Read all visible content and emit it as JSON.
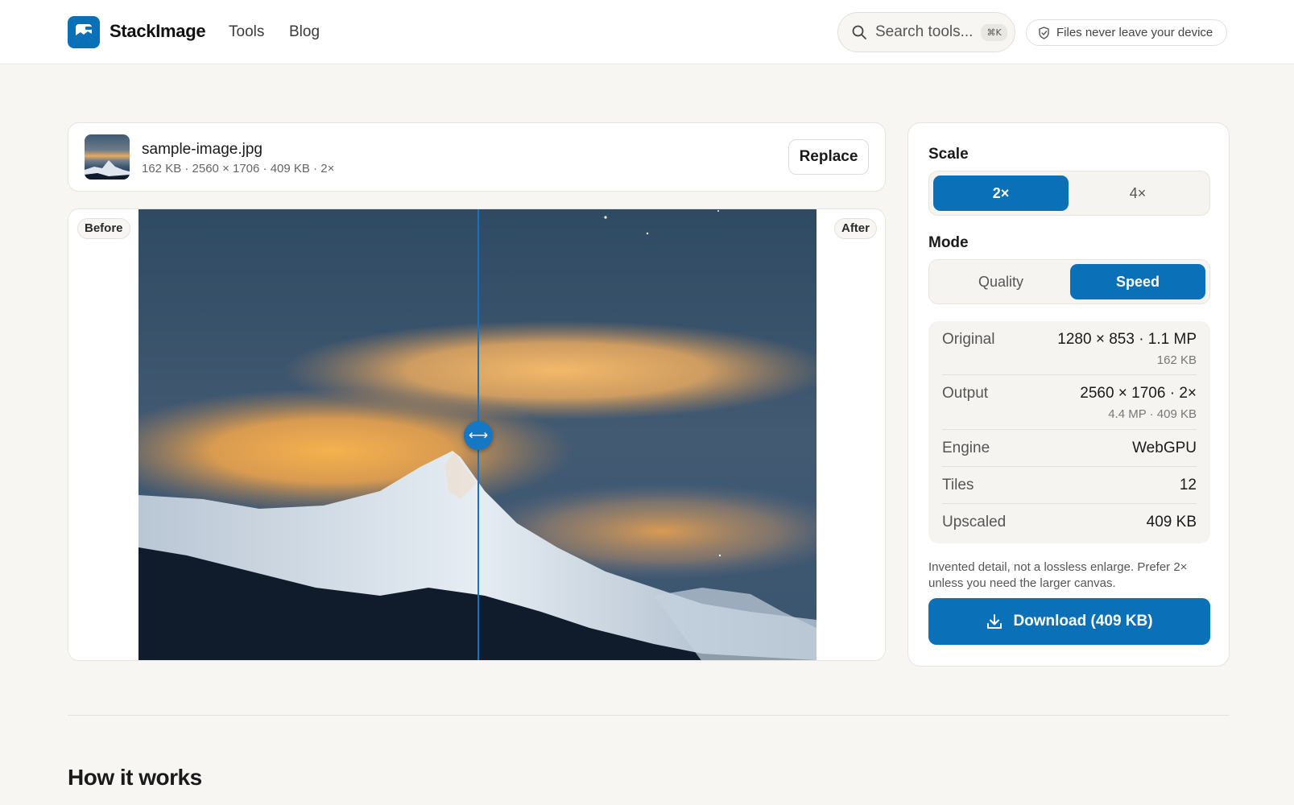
{
  "header": {
    "brand": "StackImage",
    "nav": [
      "Tools",
      "Blog"
    ],
    "search_placeholder": "Search tools...",
    "search_shortcut": "⌘K",
    "privacy_badge": "Files never leave your device"
  },
  "file": {
    "name": "sample-image.jpg",
    "meta": "162 KB · 2560 × 1706 · 409 KB · 2×",
    "replace_label": "Replace"
  },
  "compare": {
    "before_label": "Before",
    "after_label": "After",
    "handle_icon": "⟷"
  },
  "panel": {
    "scale_heading": "Scale",
    "scale_options": [
      "2×",
      "4×"
    ],
    "scale_selected": "2×",
    "mode_heading": "Mode",
    "mode_options": [
      "Quality",
      "Speed"
    ],
    "mode_selected": "Speed",
    "stats": {
      "original_label": "Original",
      "original_value": "1280 × 853 · 1.1 MP",
      "original_sub": "162 KB",
      "output_label": "Output",
      "output_value": "2560 × 1706 · 2×",
      "output_sub": "4.4 MP · 409 KB",
      "engine_label": "Engine",
      "engine_value": "WebGPU",
      "tiles_label": "Tiles",
      "tiles_value": "12",
      "upscaled_label": "Upscaled",
      "upscaled_value": "409 KB"
    },
    "note": "Invented detail, not a lossless enlarge. Prefer 2× unless you need the larger canvas.",
    "download_label": "Download (409 KB)"
  },
  "section": {
    "title": "How it works"
  },
  "colors": {
    "accent": "#0a70b8",
    "background": "#f7f6f3"
  }
}
